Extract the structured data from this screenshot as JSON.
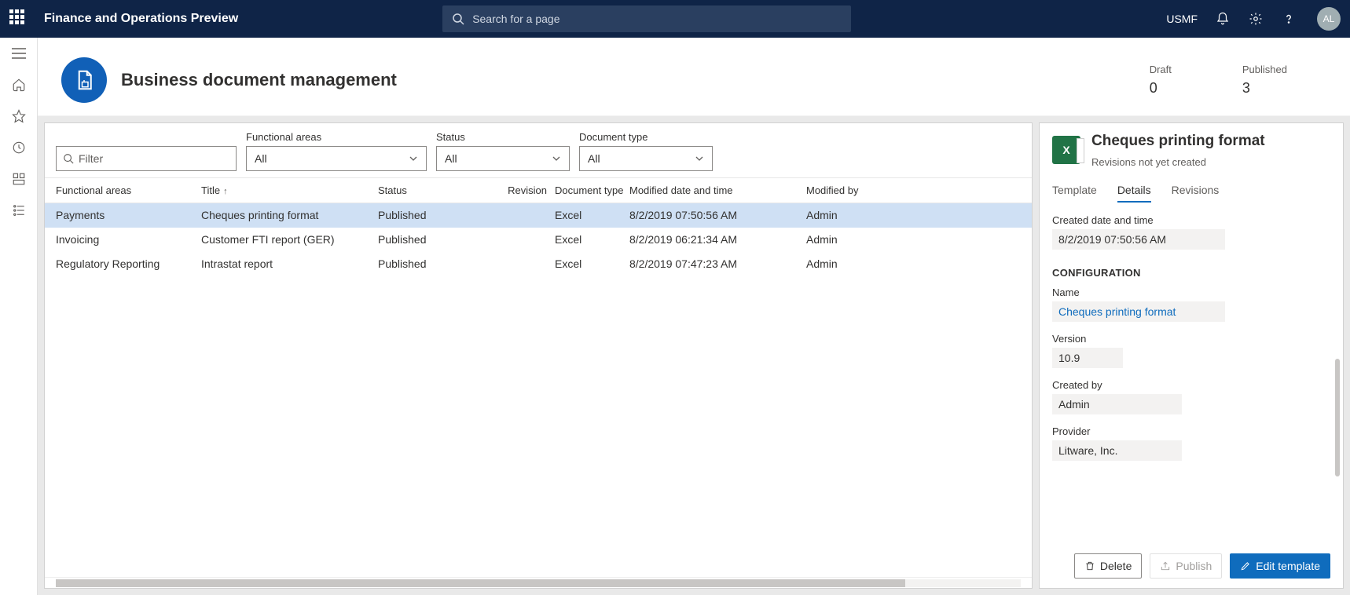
{
  "topbar": {
    "app_title": "Finance and Operations Preview",
    "search_placeholder": "Search for a page",
    "legal_entity": "USMF",
    "avatar_initials": "AL"
  },
  "page": {
    "title": "Business document management",
    "stats": {
      "draft_label": "Draft",
      "draft_value": "0",
      "published_label": "Published",
      "published_value": "3"
    }
  },
  "filters": {
    "filter_placeholder": "Filter",
    "functional_areas_label": "Functional areas",
    "functional_areas_value": "All",
    "status_label": "Status",
    "status_value": "All",
    "doctype_label": "Document type",
    "doctype_value": "All"
  },
  "grid": {
    "headers": {
      "functional_areas": "Functional areas",
      "title": "Title",
      "status": "Status",
      "revision": "Revision",
      "document_type": "Document type",
      "modified": "Modified date and time",
      "modified_by": "Modified by"
    },
    "rows": [
      {
        "fa": "Payments",
        "title": "Cheques printing format",
        "status": "Published",
        "rev": "",
        "doc": "Excel",
        "mod": "8/2/2019 07:50:56 AM",
        "by": "Admin"
      },
      {
        "fa": "Invoicing",
        "title": "Customer FTI report (GER)",
        "status": "Published",
        "rev": "",
        "doc": "Excel",
        "mod": "8/2/2019 06:21:34 AM",
        "by": "Admin"
      },
      {
        "fa": "Regulatory Reporting",
        "title": "Intrastat report",
        "status": "Published",
        "rev": "",
        "doc": "Excel",
        "mod": "8/2/2019 07:47:23 AM",
        "by": "Admin"
      }
    ]
  },
  "side": {
    "excel_glyph": "X",
    "title": "Cheques printing format",
    "subtitle": "Revisions not yet created",
    "tabs": {
      "template": "Template",
      "details": "Details",
      "revisions": "Revisions"
    },
    "created_label": "Created date and time",
    "created_value": "8/2/2019 07:50:56 AM",
    "config_header": "CONFIGURATION",
    "name_label": "Name",
    "name_value": "Cheques printing format",
    "version_label": "Version",
    "version_value": "10.9",
    "createdby_label": "Created by",
    "createdby_value": "Admin",
    "provider_label": "Provider",
    "provider_value": "Litware, Inc.",
    "buttons": {
      "delete": "Delete",
      "publish": "Publish",
      "edit": "Edit template"
    }
  }
}
